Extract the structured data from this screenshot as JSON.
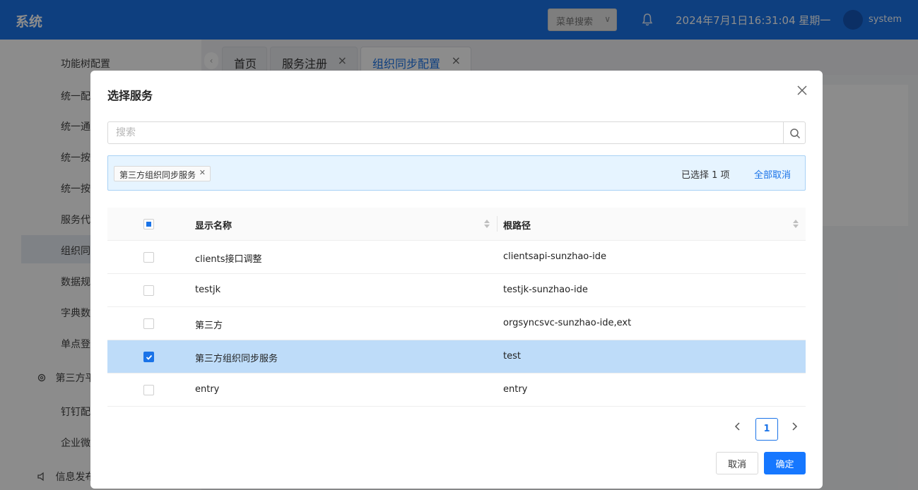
{
  "header": {
    "app_title": "系统",
    "menu_search_label": "菜单搜索",
    "datetime": "2024年7月1日16:31:04 星期一",
    "username": "system",
    "icons": [
      "bell-icon",
      "chevron-down-icon",
      "avatar"
    ]
  },
  "sidebar": {
    "items": [
      "功能树配置",
      "统一配",
      "统一通",
      "统一按",
      "统一按",
      "服务代",
      "组织同",
      "数据规",
      "字典数",
      "单点登"
    ],
    "groups": [
      {
        "label": "第三方平",
        "icon": "gear-icon"
      },
      {
        "label": "信息发布",
        "icon": "speaker-icon"
      }
    ],
    "sub_items": [
      "钉钉配",
      "企业微"
    ],
    "active_index": 6
  },
  "tabs": [
    {
      "label": "首页",
      "closable": false,
      "active": false
    },
    {
      "label": "服务注册",
      "closable": true,
      "active": false
    },
    {
      "label": "组织同步配置",
      "closable": true,
      "active": true
    }
  ],
  "modal": {
    "title": "选择服务",
    "search": {
      "placeholder": "搜索",
      "value": ""
    },
    "selected_tags": [
      "第三方组织同步服务"
    ],
    "selected_count_text": "已选择  1  项",
    "clear_all_label": "全部取消",
    "table": {
      "columns": [
        "显示名称",
        "根路径"
      ],
      "rows": [
        {
          "name": "clients接口调整",
          "path": "clientsapi-sunzhao-ide",
          "checked": false
        },
        {
          "name": "testjk",
          "path": "testjk-sunzhao-ide",
          "checked": false
        },
        {
          "name": "第三方",
          "path": "orgsyncsvc-sunzhao-ide,ext",
          "checked": false
        },
        {
          "name": "第三方组织同步服务",
          "path": "test",
          "checked": true
        },
        {
          "name": "entry",
          "path": "entry",
          "checked": false
        }
      ]
    },
    "pagination": {
      "current_page": "1"
    },
    "cancel_label": "取消",
    "ok_label": "确定"
  },
  "colors": {
    "primary": "#1a73e8",
    "header_bg": "#1a73e8",
    "selected_row": "#bedcf9",
    "selected_bar": "#e6f4ff"
  }
}
